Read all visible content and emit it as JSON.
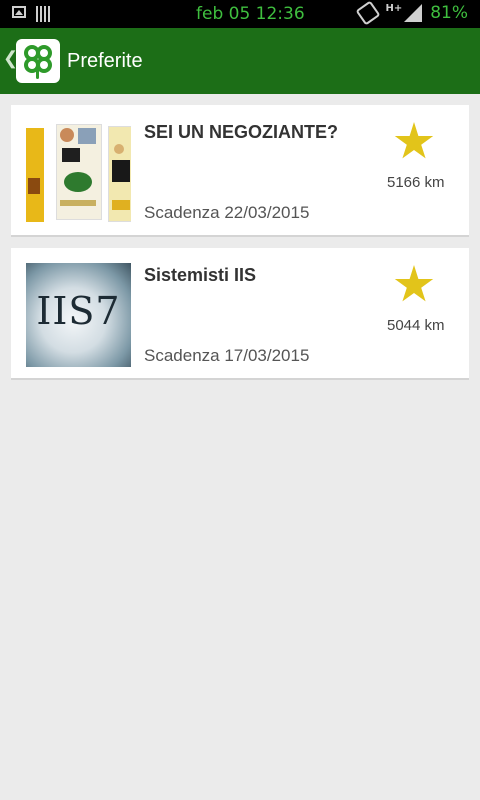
{
  "status_bar": {
    "time": "feb 05 12:36",
    "network": "H+",
    "battery": "81%"
  },
  "action_bar": {
    "back_glyph": "❮",
    "title": "Preferite",
    "logo_icon": "clover-logo"
  },
  "favorites": [
    {
      "title": "SEI UN NEGOZIANTE?",
      "expiry": "Scadenza 22/03/2015",
      "distance": "5166 km",
      "starred": true,
      "thumbnail": "flyers-collage"
    },
    {
      "title": "Sistemisti IIS",
      "expiry": "Scadenza 17/03/2015",
      "distance": "5044 km",
      "starred": true,
      "thumbnail": "iis7-banner",
      "thumbnail_text": "IIS7"
    }
  ],
  "colors": {
    "action_bar": "#1c6e17",
    "star": "#e2c41a",
    "status_text": "#3fbf3f",
    "background": "#ebebeb"
  }
}
